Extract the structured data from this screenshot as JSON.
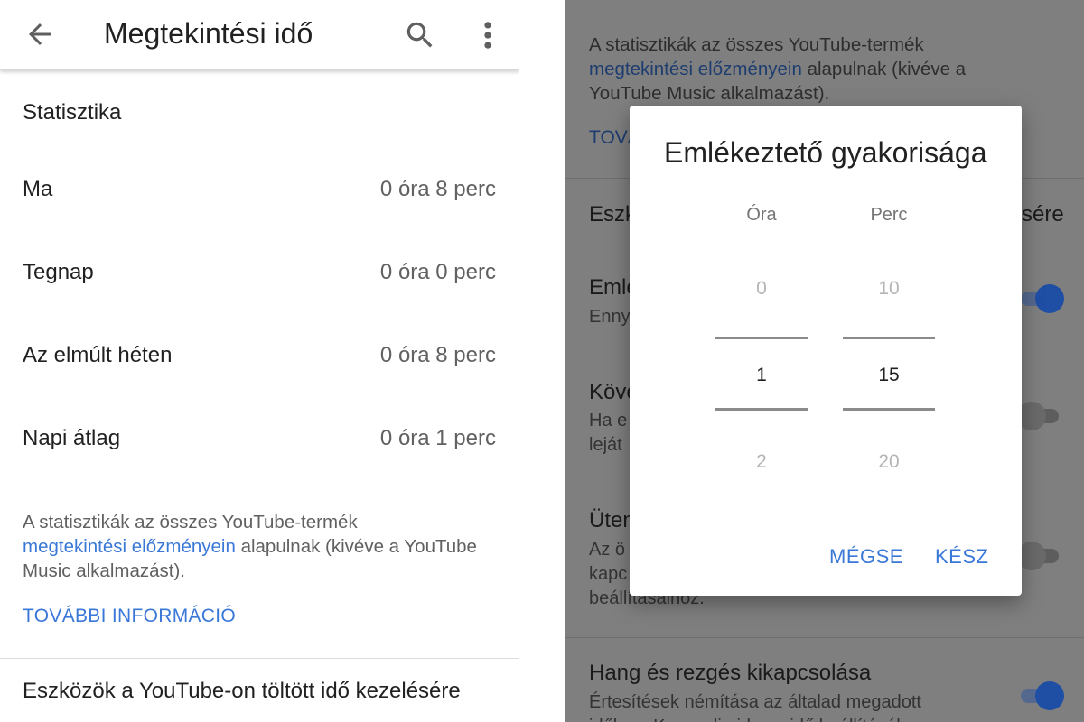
{
  "left": {
    "appbar": {
      "title": "Megtekintési idő"
    },
    "section_title": "Statisztika",
    "stats": [
      {
        "label": "Ma",
        "value": "0 óra 8 perc"
      },
      {
        "label": "Tegnap",
        "value": "0 óra 0 perc"
      },
      {
        "label": "Az elmúlt héten",
        "value": "0 óra 8 perc"
      },
      {
        "label": "Napi átlag",
        "value": "0 óra 1 perc"
      }
    ],
    "note": {
      "before": "A statisztikák az összes YouTube-termék",
      "link": "megtekintési előzményein",
      "after": "alapulnak (kivéve a YouTube Music alkalmazást)."
    },
    "more_info": "TOVÁBBI INFORMÁCIÓ",
    "tools_title": "Eszközök a YouTube-on töltött idő kezelésére"
  },
  "right": {
    "note_line1": "A statisztikák az összes YouTube-termék",
    "note_link": "megtekintési előzményein",
    "note_after": "alapulnak (kivéve a",
    "note_line3": "YouTube Music alkalmazást).",
    "more_partial": "TOVÁ",
    "tools_left": "Eszk",
    "tools_right": "sére",
    "item1_head": "Emle",
    "item1_sub": "Enny",
    "item2_head": "Köve",
    "item2_sub1": "Ha e",
    "item2_sub2": "leját",
    "item3_head": "Üten",
    "item3_sub1": "Az ö",
    "item3_sub2": "kapc",
    "item3_sub3": "beállításaihoz.",
    "item4_head": "Hang és rezgés kikapcsolása",
    "item4_sub1": "Értesítések némítása az általad megadott",
    "item4_sub2": "időben. Kapcsolja ide az idő beállításához.",
    "toggles": {
      "item1": true,
      "item2": false,
      "item3": false,
      "item4": true
    }
  },
  "dialog": {
    "title": "Emlékeztető gyakorisága",
    "hour": {
      "header": "Óra",
      "prev": "0",
      "selected": "1",
      "next": "2"
    },
    "minute": {
      "header": "Perc",
      "prev": "10",
      "selected": "15",
      "next": "20"
    },
    "cancel": "MÉGSE",
    "done": "KÉSZ"
  },
  "colors": {
    "accent": "#3a78d8",
    "toggle_on": "#1f4ea5",
    "scrim": "#7f7f7f"
  }
}
